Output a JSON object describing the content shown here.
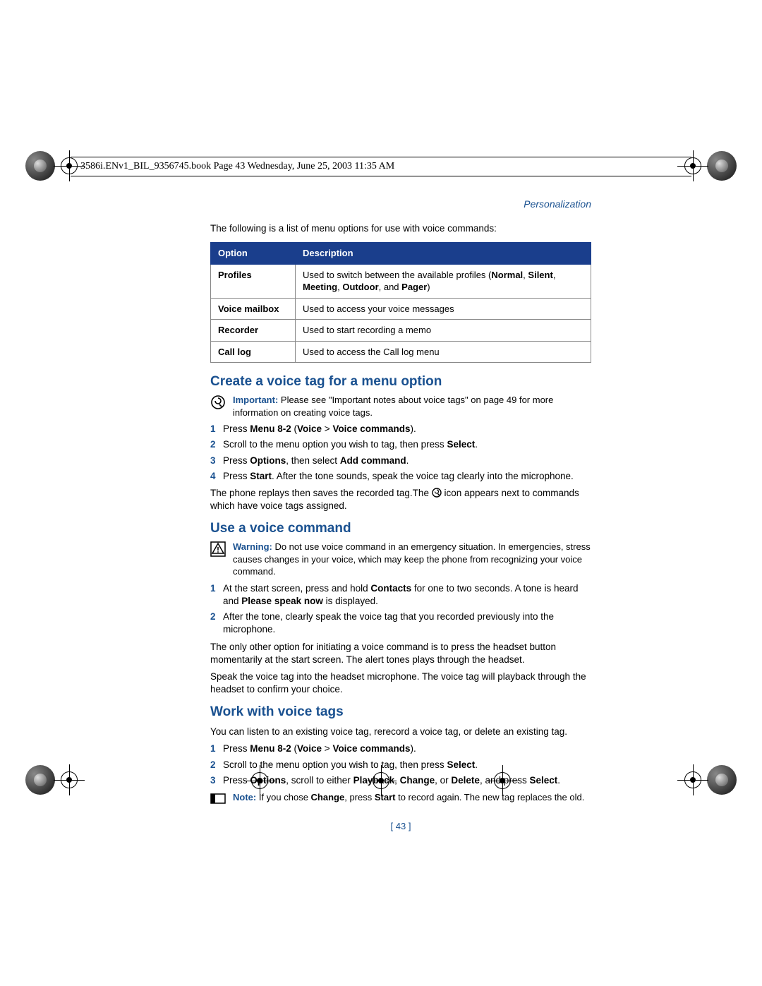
{
  "header_stamp": "3586i.ENv1_BIL_9356745.book  Page 43  Wednesday, June 25, 2003  11:35 AM",
  "chapter": "Personalization",
  "intro": "The following is a list of menu options for use with voice commands:",
  "table": {
    "headers": {
      "option": "Option",
      "description": "Description"
    },
    "rows": [
      {
        "option": "Profiles",
        "desc_pre": "Used to switch between the available profiles (",
        "desc_bold": "Normal",
        "desc_mid1": ", ",
        "desc_bold2": "Silent",
        "desc_mid2": ", ",
        "desc_bold3": "Meeting",
        "desc_mid3": ", ",
        "desc_bold4": "Outdoor",
        "desc_mid4": ", and ",
        "desc_bold5": "Pager",
        "desc_post": ")"
      },
      {
        "option": "Voice mailbox",
        "desc": "Used to access your voice messages"
      },
      {
        "option": "Recorder",
        "desc": "Used to start recording a memo"
      },
      {
        "option": "Call log",
        "desc": "Used to access the Call log menu"
      }
    ]
  },
  "h1": "Create a voice tag for a menu option",
  "important": {
    "lead": "Important:",
    "text": " Please see \"Important notes about voice tags\" on page 49 for more information on creating voice tags."
  },
  "steps1": [
    {
      "n": "1",
      "pre": "Press ",
      "b1": "Menu 8-2",
      "mid": " (",
      "b2": "Voice",
      "mid2": " > ",
      "b3": "Voice commands",
      "post": ")."
    },
    {
      "n": "2",
      "pre": "Scroll to the menu option you wish to tag, then press ",
      "b1": "Select",
      "post": "."
    },
    {
      "n": "3",
      "pre": "Press ",
      "b1": "Options",
      "mid": ", then select ",
      "b2": "Add command",
      "post": "."
    },
    {
      "n": "4",
      "pre": "Press ",
      "b1": "Start",
      "post": ". After the tone sounds, speak the voice tag clearly into the microphone."
    }
  ],
  "after_steps1_pre": "The phone replays then saves the recorded tag.The ",
  "after_steps1_post": " icon appears next to commands which have voice tags assigned.",
  "h2": "Use a voice command",
  "warning": {
    "lead": "Warning:",
    "text": " Do not use voice command in an emergency situation. In emergencies, stress causes changes in your voice, which may keep the phone from recognizing your voice command."
  },
  "steps2": [
    {
      "n": "1",
      "pre": "At the start screen, press and hold ",
      "b1": "Contacts",
      "mid": " for one to two seconds. A tone is heard and ",
      "b2": "Please speak now",
      "post": " is displayed."
    },
    {
      "n": "2",
      "pre": "After the tone, clearly speak the voice tag that you recorded previously into the microphone."
    }
  ],
  "para1": "The only other option for initiating a voice command is to press the headset button momentarily at the start screen. The alert tones plays through the headset.",
  "para2": "Speak the voice tag into the headset microphone. The voice tag will playback through the headset to confirm your choice.",
  "h3": "Work with voice tags",
  "para3": "You can listen to an existing voice tag, rerecord a voice tag, or delete an existing tag.",
  "steps3": [
    {
      "n": "1",
      "pre": "Press ",
      "b1": "Menu 8-2",
      "mid": " (",
      "b2": "Voice",
      "mid2": " > ",
      "b3": "Voice commands",
      "post": ")."
    },
    {
      "n": "2",
      "pre": "Scroll to the menu option you wish to tag, then press ",
      "b1": "Select",
      "post": "."
    },
    {
      "n": "3",
      "pre": "Press ",
      "b1": "Options",
      "mid": ", scroll to either ",
      "b2": "Playback",
      "mid2": ", ",
      "b3": "Change",
      "mid3": ", or ",
      "b4": "Delete",
      "mid4": ", and press ",
      "b5": "Select",
      "post": "."
    }
  ],
  "note": {
    "lead": "Note:",
    "pre": " If you chose ",
    "b1": "Change",
    "mid": ", press ",
    "b2": "Start",
    "post": " to record again. The new tag replaces the old."
  },
  "page_number": "[ 43 ]"
}
